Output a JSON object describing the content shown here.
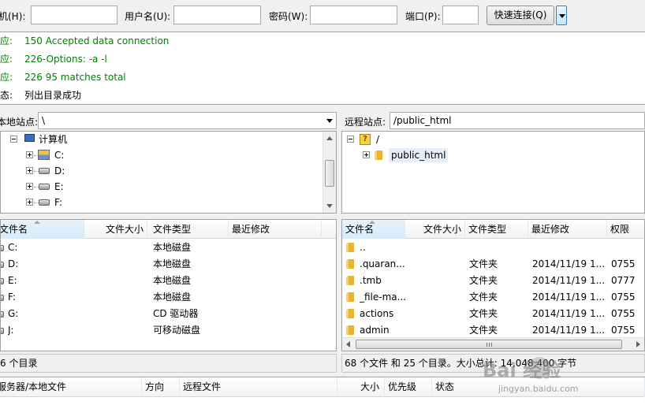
{
  "quickconnect": {
    "host_label": "主机(H):",
    "user_label": "用户名(U):",
    "pass_label": "密码(W):",
    "port_label": "端口(P):",
    "host_value": "",
    "user_value": "",
    "pass_value": "",
    "port_value": "",
    "connect_button": "快速连接(Q)"
  },
  "log": [
    {
      "label": "响应:",
      "message": "150 Accepted data connection",
      "color": "#008000"
    },
    {
      "label": "响应:",
      "message": "226-Options: -a -l",
      "color": "#008000"
    },
    {
      "label": "响应:",
      "message": "226 95 matches total",
      "color": "#008000"
    },
    {
      "label": "状态:",
      "message": "列出目录成功",
      "color": "#000000"
    }
  ],
  "local": {
    "site_label": "本地站点:",
    "path": "\\",
    "tree": {
      "root": "计算机",
      "drives": [
        "C:",
        "D:",
        "E:",
        "F:"
      ]
    },
    "columns": [
      "文件名",
      "文件大小",
      "文件类型",
      "最近修改"
    ],
    "files": [
      {
        "name": "C:",
        "type": "本地磁盘"
      },
      {
        "name": "D:",
        "type": "本地磁盘"
      },
      {
        "name": "E:",
        "type": "本地磁盘"
      },
      {
        "name": "F:",
        "type": "本地磁盘"
      },
      {
        "name": "G:",
        "type": "CD 驱动器"
      },
      {
        "name": "J:",
        "type": "可移动磁盘"
      }
    ],
    "status": "6 个目录"
  },
  "remote": {
    "site_label": "远程站点:",
    "path": "/public_html",
    "tree": {
      "root": "/",
      "child": "public_html"
    },
    "columns": [
      "文件名",
      "文件大小",
      "文件类型",
      "最近修改",
      "权限"
    ],
    "files": [
      {
        "name": "..",
        "type": "",
        "modified": "",
        "perm": ""
      },
      {
        "name": ".quaran...",
        "type": "文件夹",
        "modified": "2014/11/19 1...",
        "perm": "0755"
      },
      {
        "name": ".tmb",
        "type": "文件夹",
        "modified": "2014/11/19 1...",
        "perm": "0777"
      },
      {
        "name": "_file-ma...",
        "type": "文件夹",
        "modified": "2014/11/19 1...",
        "perm": "0755"
      },
      {
        "name": "actions",
        "type": "文件夹",
        "modified": "2014/11/19 1...",
        "perm": "0755"
      },
      {
        "name": "admin",
        "type": "文件夹",
        "modified": "2014/11/19 1...",
        "perm": "0755"
      }
    ],
    "status": "68 个文件 和 25 个目录。大小总计: 14,048,400 字节"
  },
  "queue": {
    "columns": [
      "服务器/本地文件",
      "方向",
      "远程文件",
      "大小",
      "优先级",
      "状态"
    ]
  },
  "watermark": {
    "text": "Bai 经验",
    "url": "jingyan.baidu.com"
  }
}
